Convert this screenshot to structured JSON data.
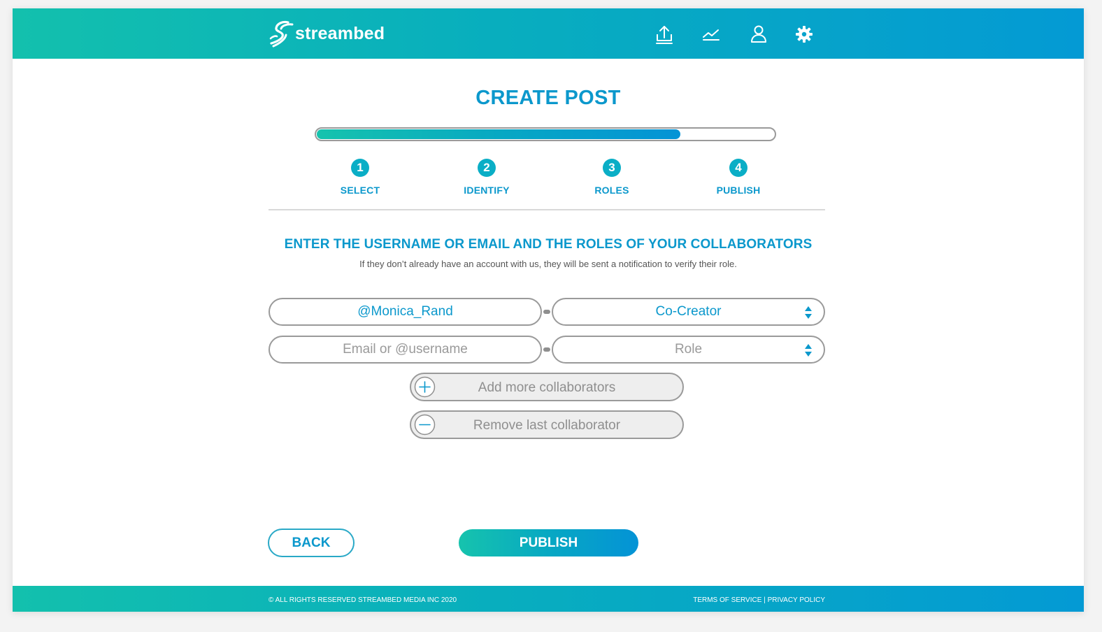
{
  "header": {
    "brand": "streambed",
    "nav_icons": [
      "upload-icon",
      "analytics-icon",
      "profile-icon",
      "settings-icon"
    ]
  },
  "page": {
    "title": "CREATE POST",
    "progress_fraction": 0.795
  },
  "steps": [
    {
      "number": "1",
      "label": "SELECT"
    },
    {
      "number": "2",
      "label": "IDENTIFY"
    },
    {
      "number": "3",
      "label": "ROLES"
    },
    {
      "number": "4",
      "label": "PUBLISH"
    }
  ],
  "form": {
    "heading": "ENTER THE USERNAME OR EMAIL AND THE ROLES OF YOUR COLLABORATORS",
    "subheading": "If they don’t already have an account with us, they will be sent a notification to verify their role.",
    "collaborators": [
      {
        "username_value": "@Monica_Rand",
        "role_value": "Co-Creator"
      },
      {
        "username_placeholder": "Email or @username",
        "role_placeholder": "Role"
      }
    ],
    "add_label": "Add more collaborators",
    "remove_label": "Remove last collaborator"
  },
  "actions": {
    "back_label": "BACK",
    "publish_label": "PUBLISH"
  },
  "footer": {
    "copyright": "© ALL RIGHTS RESERVED STREAMBED MEDIA INC 2020",
    "terms": "TERMS OF SERVICE",
    "separator": "|",
    "privacy": "PRIVACY POLICY"
  },
  "colors": {
    "accent": "#0b98cc",
    "gradient_start": "#13c0ad",
    "gradient_end": "#049ad4",
    "step_circle": "#0aaec6"
  }
}
